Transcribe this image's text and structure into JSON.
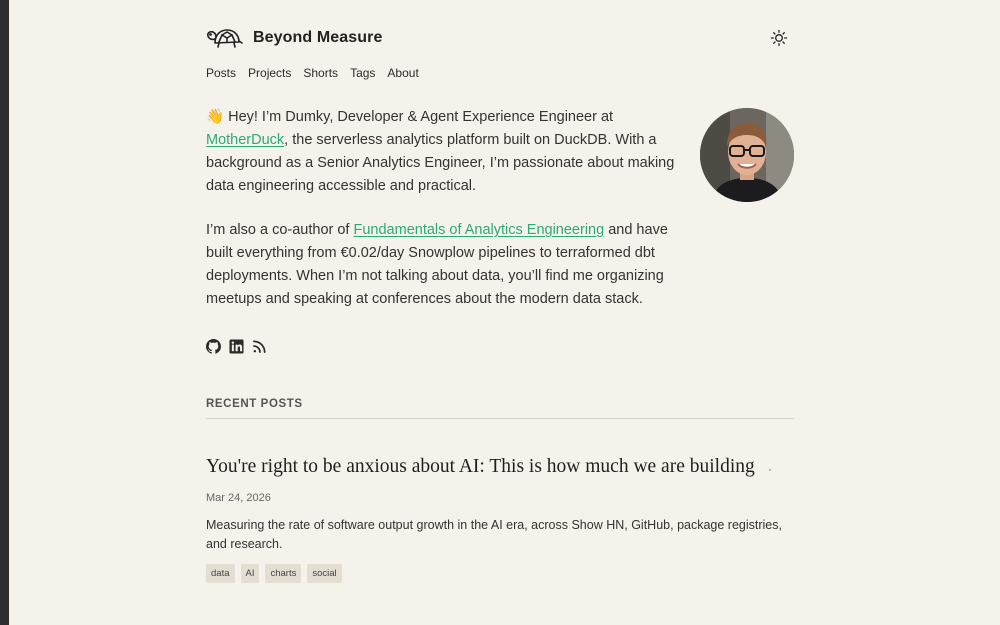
{
  "site": {
    "title": "Beyond Measure"
  },
  "nav": {
    "items": [
      "Posts",
      "Projects",
      "Shorts",
      "Tags",
      "About"
    ]
  },
  "intro": {
    "emoji": "👋",
    "p1_a": " Hey! I’m Dumky, Developer & Agent Experience Engineer at ",
    "p1_link": "MotherDuck",
    "p1_b": ", the serverless analytics platform built on DuckDB. With a background as a Senior Analytics Engineer, I’m passionate about making data engineering accessible and practical.",
    "p2_a": "I’m also a co-author of ",
    "p2_link": "Fundamentals of Analytics Engineering",
    "p2_b": " and have built everything from €0.02/day Snowplow pipelines to terraformed dbt deployments. When I’m not talking about data, you’ll find me organizing meetups and speaking at conferences about the modern data stack."
  },
  "socials": {
    "icons": [
      "github-icon",
      "linkedin-icon",
      "rss-icon"
    ]
  },
  "recent_posts": {
    "heading": "RECENT POSTS",
    "posts": [
      {
        "title": "You're right to be anxious about AI: This is how much we are building",
        "marker": "·",
        "date": "Mar 24, 2026",
        "description": "Measuring the rate of software output growth in the AI era, across Show HN, GitHub, package registries, and research.",
        "tags": [
          "data",
          "AI",
          "charts",
          "social"
        ]
      }
    ]
  },
  "colors": {
    "background": "#f5f2ec",
    "link": "#2bab74",
    "tag_bg": "#e4ddd1",
    "text": "#2b2b2b"
  }
}
